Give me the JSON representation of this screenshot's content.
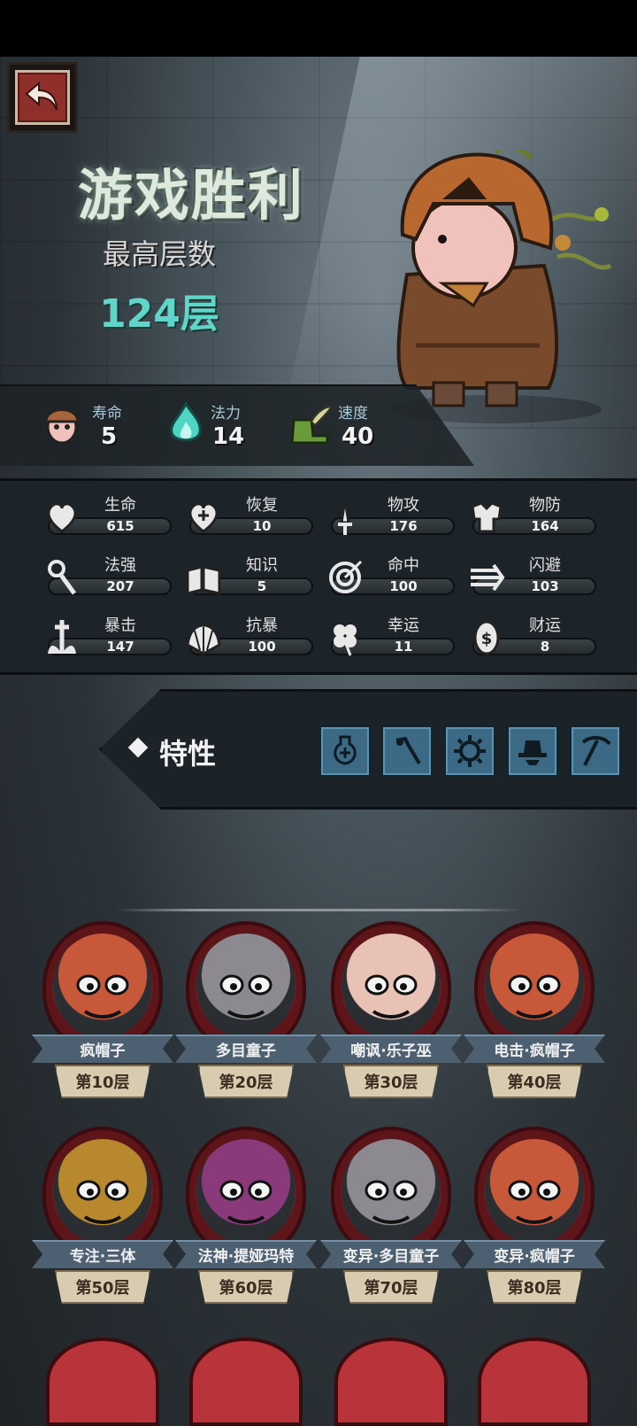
{
  "result": {
    "title": "游戏胜利",
    "floor_label": "最高层数",
    "floor_value": "124层"
  },
  "top_stats": [
    {
      "icon": "mushroom-hero-icon",
      "label": "寿命",
      "value": "5"
    },
    {
      "icon": "blue-flame-icon",
      "label": "法力",
      "value": "14"
    },
    {
      "icon": "winged-boot-icon",
      "label": "速度",
      "value": "40"
    }
  ],
  "stats": [
    {
      "icon": "heart-icon",
      "label": "生命",
      "value": "615"
    },
    {
      "icon": "heart-plus-icon",
      "label": "恢复",
      "value": "10"
    },
    {
      "icon": "sword-icon",
      "label": "物攻",
      "value": "176"
    },
    {
      "icon": "armor-icon",
      "label": "物防",
      "value": "164"
    },
    {
      "icon": "staff-icon",
      "label": "法强",
      "value": "207"
    },
    {
      "icon": "book-icon",
      "label": "知识",
      "value": "5"
    },
    {
      "icon": "target-icon",
      "label": "命中",
      "value": "100"
    },
    {
      "icon": "dash-arrows-icon",
      "label": "闪避",
      "value": "103"
    },
    {
      "icon": "crit-dagger-icon",
      "label": "暴击",
      "value": "147"
    },
    {
      "icon": "shell-shield-icon",
      "label": "抗暴",
      "value": "100"
    },
    {
      "icon": "clover-icon",
      "label": "幸运",
      "value": "11"
    },
    {
      "icon": "coin-icon",
      "label": "财运",
      "value": "8"
    }
  ],
  "traits": {
    "label": "特性",
    "icons": [
      "potion-icon",
      "wand-icon",
      "gear-icon",
      "hat-icon",
      "pickaxe-icon"
    ]
  },
  "bosses": [
    {
      "name": "疯帽子",
      "floor": "第10层"
    },
    {
      "name": "多目童子",
      "floor": "第20层"
    },
    {
      "name": "嘲讽·乐子巫",
      "floor": "第30层"
    },
    {
      "name": "电击·疯帽子",
      "floor": "第40层"
    },
    {
      "name": "专注·三体",
      "floor": "第50层"
    },
    {
      "name": "法神·提娅玛特",
      "floor": "第60层"
    },
    {
      "name": "变异·多目童子",
      "floor": "第70层"
    },
    {
      "name": "变异·疯帽子",
      "floor": "第80层"
    }
  ],
  "colors": {
    "accent_teal": "#5fd6c9",
    "back_button_red": "#8f2f2b",
    "trait_blue": "#3c6a86",
    "boss_frame_red": "#b9333a"
  }
}
